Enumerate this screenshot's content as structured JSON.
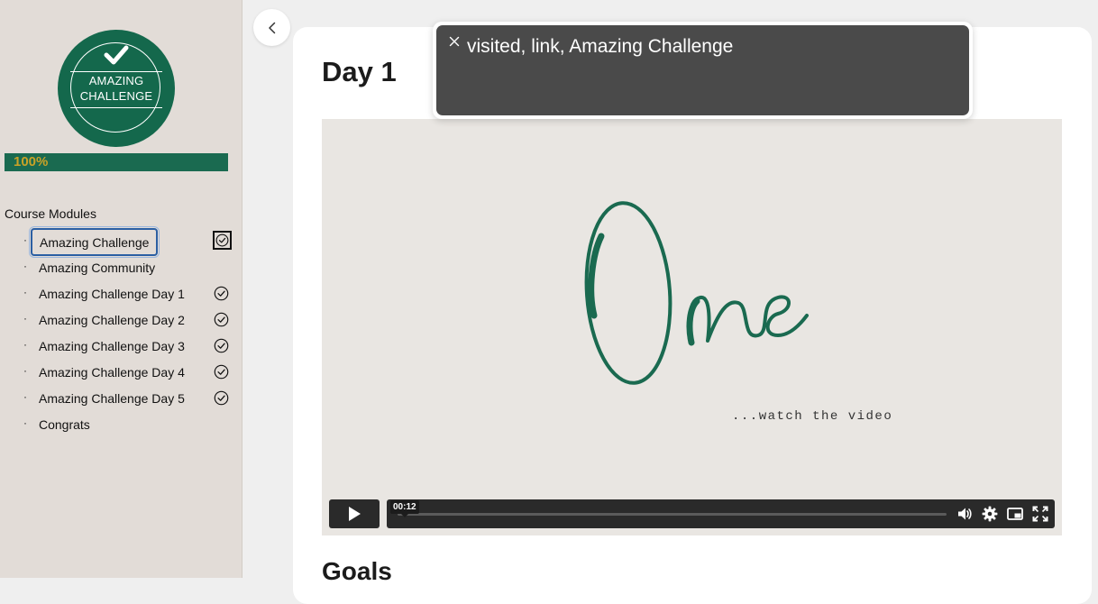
{
  "logo": {
    "line1": "AMAZING",
    "line2": "CHALLENGE"
  },
  "progress": {
    "label": "100%",
    "value": 1.0
  },
  "sidebar": {
    "title": "Course Modules",
    "bullet": "·",
    "items": [
      {
        "label": "Amazing Challenge",
        "completed": true,
        "active": true
      },
      {
        "label": "Amazing Community",
        "completed": false
      },
      {
        "label": "Amazing Challenge Day 1",
        "completed": true
      },
      {
        "label": "Amazing Challenge Day 2",
        "completed": true
      },
      {
        "label": "Amazing Challenge Day 3",
        "completed": true
      },
      {
        "label": "Amazing Challenge Day 4",
        "completed": true
      },
      {
        "label": "Amazing Challenge Day 5",
        "completed": true
      },
      {
        "label": "Congrats",
        "completed": false
      }
    ]
  },
  "main": {
    "title": "Day 1",
    "section_heading": "Goals",
    "video": {
      "tagline": "...watch the video",
      "current_time": "00:12",
      "played_fraction": 0.0
    }
  },
  "voiceover": {
    "text": "visited, link, Amazing Challenge"
  },
  "colors": {
    "brand_green": "#14684c",
    "progress_label": "#c9a227",
    "sidebar_bg": "#e2dcd7"
  },
  "icons": {
    "back": "chevron-left-icon",
    "completed": "check-circle-icon",
    "play": "play-icon",
    "volume": "volume-icon",
    "settings": "gear-icon",
    "pip": "picture-in-picture-icon",
    "fullscreen": "fullscreen-icon",
    "close": "close-icon"
  }
}
